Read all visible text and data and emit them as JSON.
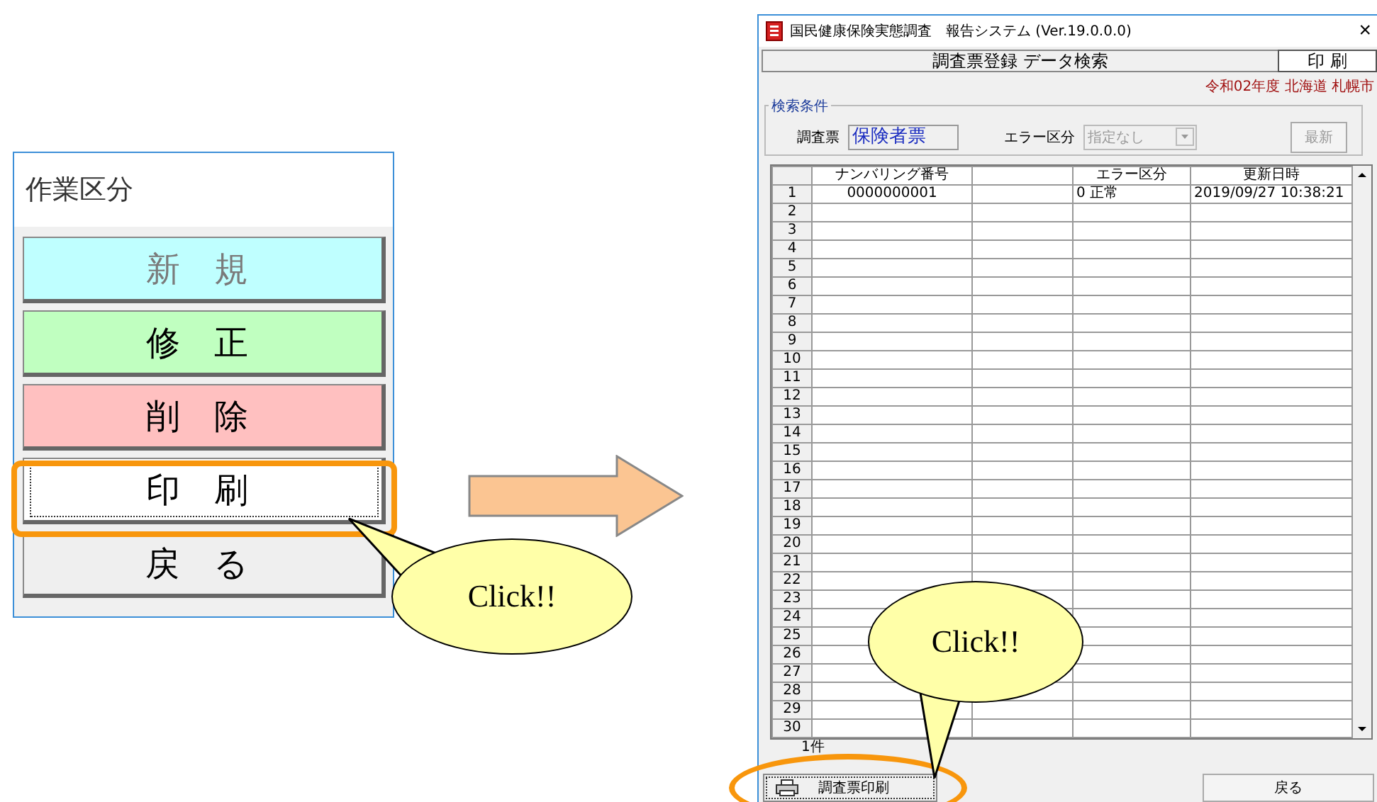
{
  "work_panel": {
    "title": "作業区分",
    "buttons": [
      {
        "label": "新 規",
        "color": "#bfffff",
        "disabled": true,
        "focused": false
      },
      {
        "label": "修 正",
        "color": "#c0ffc0",
        "disabled": false,
        "focused": false
      },
      {
        "label": "削 除",
        "color": "#ffc0c0",
        "disabled": false,
        "focused": false
      },
      {
        "label": "印 刷",
        "color": "#ffffff",
        "disabled": false,
        "focused": true
      },
      {
        "label": "戻 る",
        "color": "#efefef",
        "disabled": false,
        "focused": false
      }
    ]
  },
  "callouts": [
    {
      "text": "Click!!"
    },
    {
      "text": "Click!!"
    }
  ],
  "window": {
    "title": "国民健康保険実態調査　報告システム (Ver.19.0.0.0)",
    "close": "×",
    "header": "調査票登録 データ検索",
    "mode": "印 刷",
    "context": "令和02年度 北海道 札幌市",
    "search": {
      "legend": "検索条件",
      "form_label": "調査票",
      "form_value": "保険者票",
      "error_label": "エラー区分",
      "error_placeholder": "指定なし",
      "refresh": "最新",
      "refresh_disabled": true
    },
    "table": {
      "columns": [
        "ナンバリング番号",
        "",
        "エラー区分",
        "更新日時"
      ],
      "rows": [
        {
          "no": "1",
          "cells": [
            "0000000001",
            "",
            "0 正常",
            "2019/09/27 10:38:21"
          ]
        },
        {
          "no": "2"
        },
        {
          "no": "3"
        },
        {
          "no": "4"
        },
        {
          "no": "5"
        },
        {
          "no": "6"
        },
        {
          "no": "7"
        },
        {
          "no": "8"
        },
        {
          "no": "9"
        },
        {
          "no": "10"
        },
        {
          "no": "11"
        },
        {
          "no": "12"
        },
        {
          "no": "13"
        },
        {
          "no": "14"
        },
        {
          "no": "15"
        },
        {
          "no": "16"
        },
        {
          "no": "17"
        },
        {
          "no": "18"
        },
        {
          "no": "19"
        },
        {
          "no": "20"
        },
        {
          "no": "21"
        },
        {
          "no": "22"
        },
        {
          "no": "23"
        },
        {
          "no": "24"
        },
        {
          "no": "25"
        },
        {
          "no": "26"
        },
        {
          "no": "27"
        },
        {
          "no": "28"
        },
        {
          "no": "29"
        },
        {
          "no": "30"
        }
      ]
    },
    "count": "1件",
    "print_button": "調査票印刷",
    "back_button": "戻る"
  }
}
